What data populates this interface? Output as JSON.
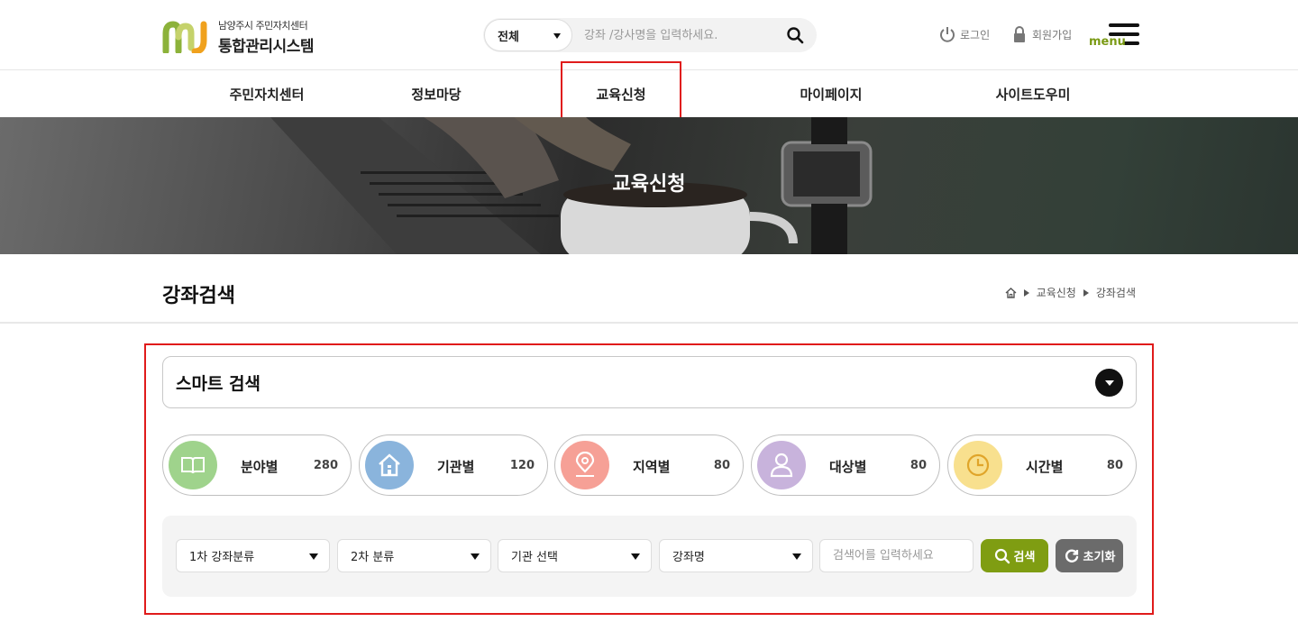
{
  "header": {
    "logo_sub": "남양주시 주민자치센터",
    "logo_main": "통합관리시스템",
    "search": {
      "scope_value": "전체",
      "placeholder": "강좌 /강사명을 입력하세요."
    },
    "login_label": "로그인",
    "join_label": "회원가입",
    "menu_label": "menu"
  },
  "gnb": {
    "items": [
      "주민자치센터",
      "정보마당",
      "교육신청",
      "마이페이지",
      "사이트도우미"
    ],
    "active_index": 2
  },
  "hero": {
    "title": "교육신청"
  },
  "page": {
    "title": "강좌검색",
    "breadcrumb": [
      "교육신청",
      "강좌검색"
    ]
  },
  "smart_search": {
    "title": "스마트 검색",
    "categories": [
      {
        "label": "분야별",
        "count": "280",
        "icon": "book-icon",
        "color": "#9fd38c"
      },
      {
        "label": "기관별",
        "count": "120",
        "icon": "house-icon",
        "color": "#8ab4dc"
      },
      {
        "label": "지역별",
        "count": "80",
        "icon": "map-pin-icon",
        "color": "#f6a096"
      },
      {
        "label": "대상별",
        "count": "80",
        "icon": "person-icon",
        "color": "#c8b3dc"
      },
      {
        "label": "시간별",
        "count": "80",
        "icon": "clock-icon",
        "color": "#f8e08e"
      }
    ],
    "filters": {
      "primary": "1차 강좌분류",
      "secondary": "2차 분류",
      "institution": "기관 선택",
      "field": "강좌명",
      "keyword_placeholder": "검색어를 입력하세요",
      "search_label": "검색",
      "reset_label": "초기화"
    }
  },
  "colors": {
    "accent_green": "#7f9d12",
    "highlight_red": "#e01b1b"
  }
}
